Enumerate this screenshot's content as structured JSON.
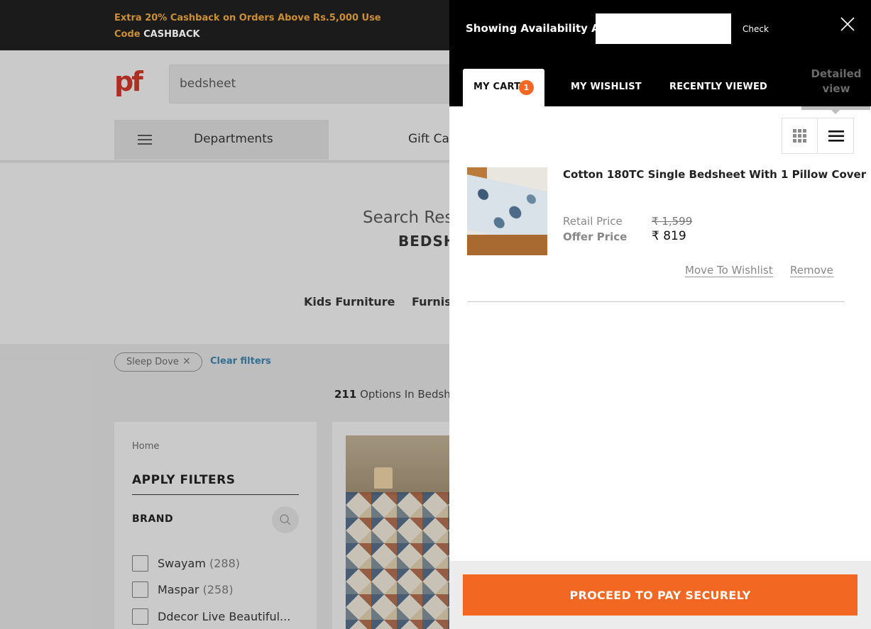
{
  "promo": {
    "text": "Extra 20% Cashback on Orders Above Rs.5,000 Use Code",
    "code": "CASHBACK"
  },
  "header": {
    "logo": "pf",
    "search_value": "bedsheet",
    "departments_label": "Departments",
    "gift_label": "Gift Car"
  },
  "results": {
    "heading": "Search Res",
    "term": "BEDSH",
    "categories": [
      "Kids Furniture",
      "Furnish"
    ]
  },
  "filters": {
    "chip_label": "Sleep Dove",
    "clear_label": "Clear filters",
    "count": "211",
    "count_suffix": "Options In Bedshe",
    "breadcrumb": "Home",
    "apply_title": "APPLY FILTERS",
    "brand_title": "BRAND",
    "brands": [
      {
        "name": "Swayam",
        "count": "(288)"
      },
      {
        "name": "Maspar",
        "count": "(258)"
      },
      {
        "name": "Ddecor Live Beautiful...",
        "count": ""
      }
    ]
  },
  "drawer": {
    "availability_label": "Showing Availability At",
    "pincode_value": "",
    "check_label": "Check",
    "tabs": {
      "cart": "MY CART",
      "cart_badge": "1",
      "wishlist": "MY WISHLIST",
      "recent": "RECENTLY VIEWED"
    },
    "detailed_view": "Detailed view",
    "item": {
      "title": "Cotton 180TC Single Bedsheet With 1 Pillow Cover",
      "retail_label": "Retail Price",
      "retail_price": "₹ 1,599",
      "offer_label": "Offer Price",
      "offer_price": "₹ 819",
      "move_label": "Move To Wishlist",
      "remove_label": "Remove"
    },
    "proceed_label": "PROCEED TO PAY SECURELY"
  },
  "colors": {
    "accent": "#f26722",
    "promo_text": "#e8a33d",
    "brand_logo": "#c8352a",
    "link_blue": "#3a7ea6"
  }
}
